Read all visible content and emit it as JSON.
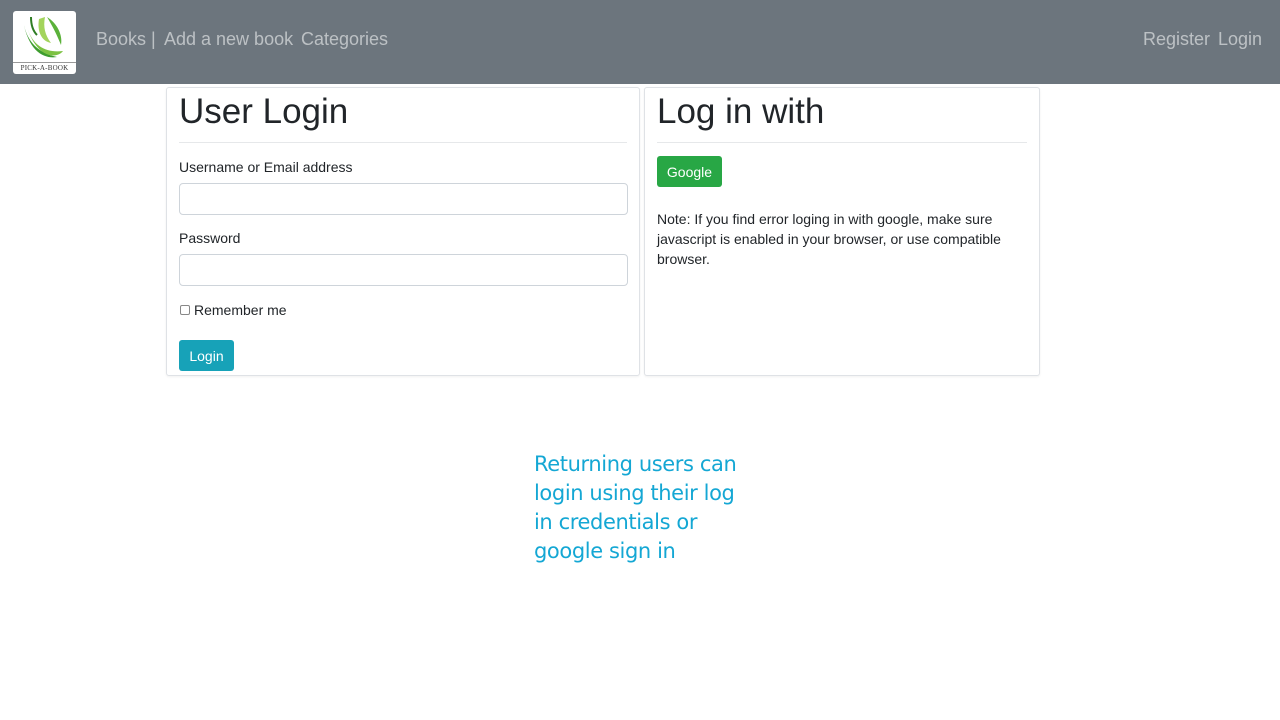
{
  "navbar": {
    "logo_text": "PICK-A-BOOK",
    "links": [
      "Books |",
      "Add a new book",
      "Categories"
    ],
    "right_links": [
      "Register",
      "Login"
    ]
  },
  "login_card": {
    "title": "User Login",
    "username_label": "Username or Email address",
    "username_value": "",
    "password_label": "Password",
    "password_value": "",
    "remember_label": "Remember me",
    "remember_checked": false,
    "login_button": "Login"
  },
  "social_card": {
    "title": "Log in with",
    "google_button": "Google",
    "note": "Note: If you find error loging in with google, make sure javascript is enabled in your browser, or use compatible browser."
  },
  "annotation": {
    "text": "Returning users can login using their log in credentials or google sign in"
  },
  "colors": {
    "navbar": "#6c757d",
    "login_button": "#17a2b8",
    "google_button": "#28a745",
    "annotation": "#14a7d4"
  }
}
